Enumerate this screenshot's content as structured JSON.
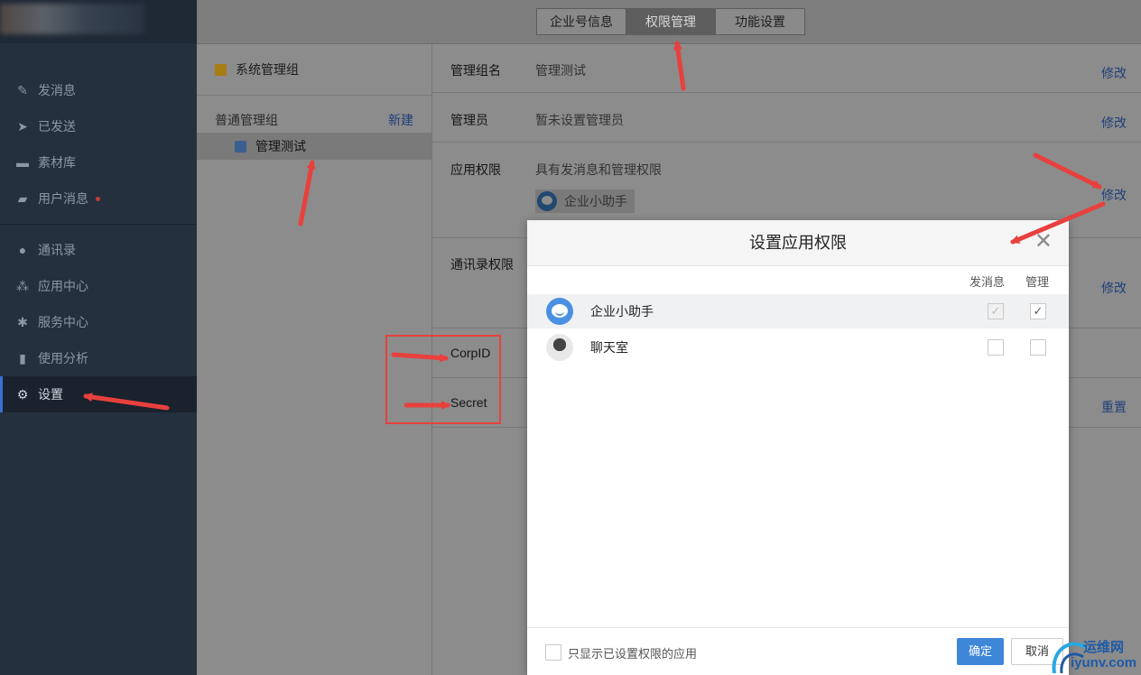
{
  "sidebar": {
    "items": [
      {
        "label": "发消息",
        "icon": "pencil-icon"
      },
      {
        "label": "已发送",
        "icon": "send-icon"
      },
      {
        "label": "素材库",
        "icon": "briefcase-icon"
      },
      {
        "label": "用户消息",
        "icon": "chat-icon",
        "badge_dot": true
      },
      {
        "label": "通讯录",
        "icon": "person-icon"
      },
      {
        "label": "应用中心",
        "icon": "apps-icon"
      },
      {
        "label": "服务中心",
        "icon": "service-icon"
      },
      {
        "label": "使用分析",
        "icon": "bar-chart-icon"
      },
      {
        "label": "设置",
        "icon": "gear-icon",
        "active": true
      }
    ]
  },
  "tabs": [
    {
      "label": "企业号信息"
    },
    {
      "label": "权限管理",
      "active": true
    },
    {
      "label": "功能设置"
    }
  ],
  "groups": {
    "system_group": "系统管理组",
    "normal_group": "普通管理组",
    "new_label": "新建",
    "selected_group": "管理测试"
  },
  "detail": {
    "group_name_label": "管理组名",
    "group_name_value": "管理测试",
    "admin_label": "管理员",
    "admin_value": "暂未设置管理员",
    "app_perm_label": "应用权限",
    "app_perm_value": "具有发消息和管理权限",
    "app_chip": "企业小助手",
    "contacts_perm_label": "通讯录权限",
    "corpid_label": "CorpID",
    "secret_label": "Secret",
    "edit_label": "修改",
    "reset_label": "重置"
  },
  "modal": {
    "title": "设置应用权限",
    "col_send": "发消息",
    "col_manage": "管理",
    "apps": [
      {
        "name": "企业小助手",
        "send": true,
        "manage": true,
        "send_disabled": true
      },
      {
        "name": "聊天室",
        "send": false,
        "manage": false
      }
    ],
    "footer_checkbox_label": "只显示已设置权限的应用",
    "ok_label": "确定",
    "cancel_label": "取消"
  },
  "watermark": {
    "line1": "运维网",
    "line2": "iyunv.com"
  },
  "colors": {
    "annotation": "#e8403d",
    "primary_button": "#3e86d8",
    "link": "#1f3f7a"
  }
}
